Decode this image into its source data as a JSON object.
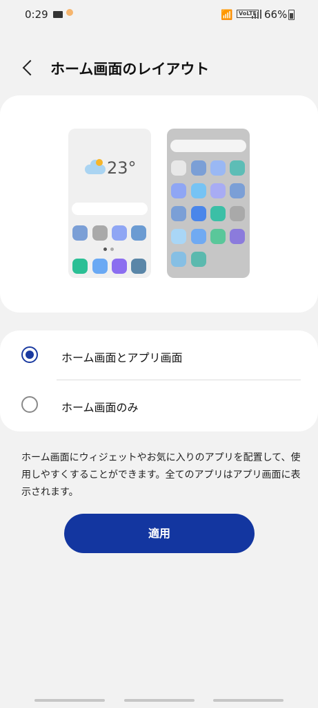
{
  "status_bar": {
    "time": "0:29",
    "battery": "66%",
    "volte": "VoLTE",
    "icons": [
      "mail-icon",
      "weather-icon",
      "wifi-icon",
      "volte-icon",
      "signal-icon",
      "battery-icon"
    ]
  },
  "header": {
    "title": "ホーム画面のレイアウト",
    "back_icon": "chevron-left-icon"
  },
  "preview": {
    "temperature": "23°",
    "home_icon_colors": [
      "#7b9fd6",
      "#a9a9a9",
      "#8fa6f4",
      "#6b9bd2",
      "#2bbf95",
      "#6aa9f4",
      "#8b6ef0",
      "#5a86a8"
    ],
    "apps_icon_colors": [
      "#e8e8e8",
      "#7b9fd6",
      "#9ab8f4",
      "#5dbdb6",
      "#8fa6f4",
      "#76c3f4",
      "#a8acf4",
      "#7b9fd6",
      "#7b9fd6",
      "#4a86ea",
      "#3bbfa6",
      "#a9a9a9",
      "#a9d6f6",
      "#70aaf2",
      "#5ac79a",
      "#8b7bdc",
      "#86bfe4",
      "#5bb9ae"
    ]
  },
  "options": [
    {
      "label": "ホーム画面とアプリ画面",
      "selected": true
    },
    {
      "label": "ホーム画面のみ",
      "selected": false
    }
  ],
  "description": "ホーム画面にウィジェットやお気に入りのアプリを配置して、使用しやすくすることができます。全てのアプリはアプリ画面に表示されます。",
  "apply_button": "適用",
  "colors": {
    "accent": "#1336a0",
    "background": "#f2f2f2"
  }
}
